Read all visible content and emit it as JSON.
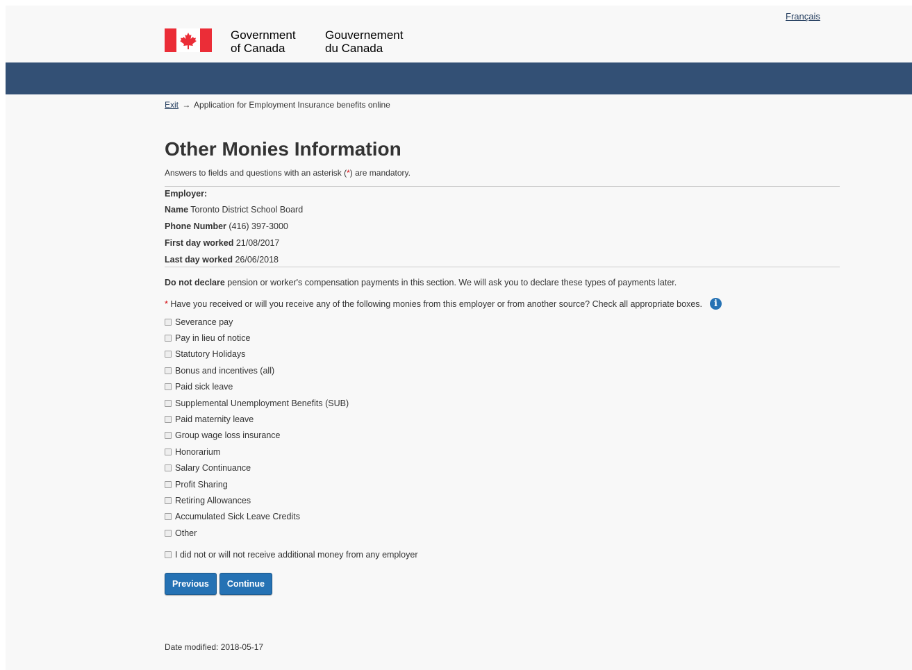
{
  "header": {
    "language_link": "Français",
    "signature_en_line1": "Government",
    "signature_en_line2": "of Canada",
    "signature_fr_line1": "Gouvernement",
    "signature_fr_line2": "du Canada",
    "brand_color": "#335075"
  },
  "breadcrumb": {
    "exit_label": "Exit",
    "arrow": "→",
    "current": "Application for Employment Insurance benefits online"
  },
  "main": {
    "title": "Other Monies Information",
    "mandatory_note_before": "Answers to fields and questions with an asterisk (",
    "mandatory_note_star": "*",
    "mandatory_note_after": ") are mandatory.",
    "employer_heading": "Employer:",
    "employer": {
      "name_label": "Name",
      "name_value": "Toronto District School Board",
      "phone_label": "Phone Number",
      "phone_value": "(416) 397-3000",
      "first_day_label": "First day worked",
      "first_day_value": "21/08/2017",
      "last_day_label": "Last day worked",
      "last_day_value": "26/06/2018"
    },
    "declare_bold": "Do not declare",
    "declare_rest": " pension or worker's compensation payments in this section. We will ask you to declare these types of payments later.",
    "question_star": "*",
    "question_text": "Have you received or will you receive any of the following monies from this employer or from another source? Check all appropriate boxes.",
    "info_icon_glyph": "i",
    "options": [
      "Severance pay",
      "Pay in lieu of notice",
      "Statutory Holidays",
      "Bonus and incentives (all)",
      "Paid sick leave",
      "Supplemental Unemployment Benefits (SUB)",
      "Paid maternity leave",
      "Group wage loss insurance",
      "Honorarium",
      "Salary Continuance",
      "Profit Sharing",
      "Retiring Allowances",
      "Accumulated Sick Leave Credits",
      "Other"
    ],
    "none_option": "I did not or will not receive additional money from any employer",
    "previous_button": "Previous",
    "continue_button": "Continue",
    "button_color": "#2572b4"
  },
  "footer": {
    "date_modified_label": "Date modified:",
    "date_modified_value": "2018-05-17"
  }
}
